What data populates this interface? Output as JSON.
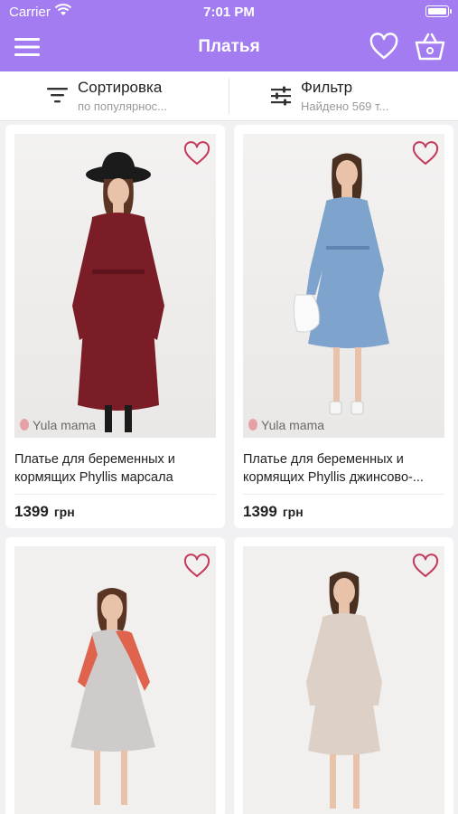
{
  "status_bar": {
    "carrier": "Carrier",
    "time": "7:01 PM"
  },
  "nav": {
    "title": "Платья"
  },
  "toolbar": {
    "sort": {
      "label": "Сортировка",
      "sub": "по популярнос..."
    },
    "filter": {
      "label": "Фильтр",
      "sub": "Найдено 569 т..."
    }
  },
  "products": [
    {
      "name": "Платье для беременных и кормящих Phyllis марсала",
      "price": "1399",
      "currency": "грн",
      "brand": "Yula mama",
      "dress_color": "#7a1d26"
    },
    {
      "name": "Платье для беременных и кормящих Phyllis джинсово-...",
      "price": "1399",
      "currency": "грн",
      "brand": "Yula mama",
      "dress_color": "#7ea3cc"
    },
    {
      "dress_color": "#cfcbca",
      "accent_color": "#e0644d"
    },
    {
      "dress_color": "#ddd0c6"
    }
  ],
  "colors": {
    "accent": "#a27cf0",
    "heart": "#c4385a"
  }
}
